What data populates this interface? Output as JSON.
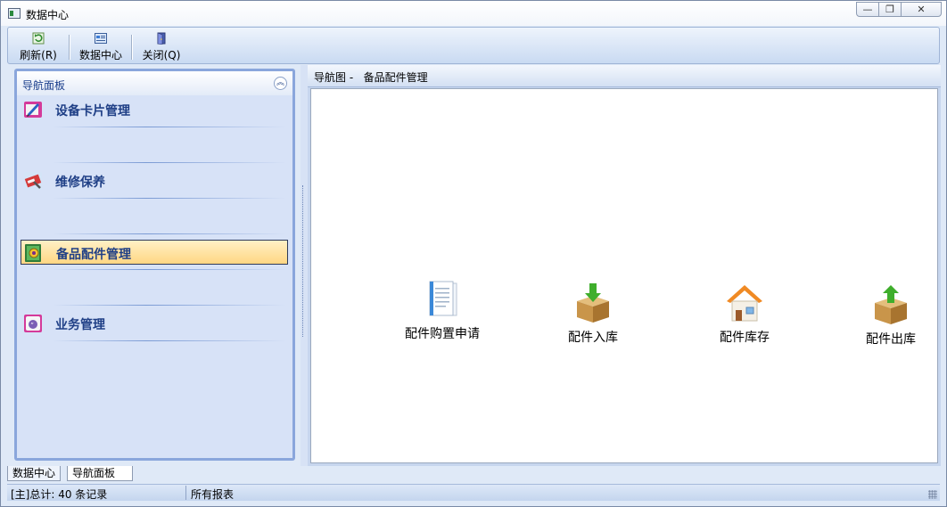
{
  "window": {
    "title": "数据中心"
  },
  "window_buttons": {
    "minimize": "—",
    "restore": "❐",
    "close": "✕"
  },
  "toolbar": {
    "buttons": [
      {
        "label": "刷新(R)",
        "icon": "refresh-icon"
      },
      {
        "label": "数据中心",
        "icon": "data-center-icon"
      },
      {
        "label": "关闭(Q)",
        "icon": "door-exit-icon"
      }
    ]
  },
  "nav_panel": {
    "title": "导航面板",
    "collapse_glyph": "︽",
    "items": [
      {
        "label": "设备卡片管理",
        "icon": "equipment-card-icon",
        "selected": false
      },
      {
        "label": "维修保养",
        "icon": "maintenance-icon",
        "selected": false
      },
      {
        "label": "备品配件管理",
        "icon": "spare-parts-icon",
        "selected": true
      },
      {
        "label": "业务管理",
        "icon": "business-icon",
        "selected": false
      }
    ]
  },
  "main_panel": {
    "header": "导航图 -   备品配件管理",
    "nodes": [
      {
        "label": "配件购置申请",
        "icon": "document-icon"
      },
      {
        "label": "配件入库",
        "icon": "box-in-icon"
      },
      {
        "label": "配件库存",
        "icon": "warehouse-house-icon"
      },
      {
        "label": "配件出库",
        "icon": "box-out-icon"
      }
    ]
  },
  "bottom_tabs": [
    {
      "label": "数据中心",
      "active": false
    },
    {
      "label": "导航面板",
      "active": true
    }
  ],
  "status_bar": {
    "record_summary": "[主]总计: 40 条记录",
    "report": "所有报表"
  },
  "colors": {
    "nav_item_text": "#1f3f86",
    "selected_bg": "#ffd783",
    "panel_border": "#8aa6dc"
  }
}
